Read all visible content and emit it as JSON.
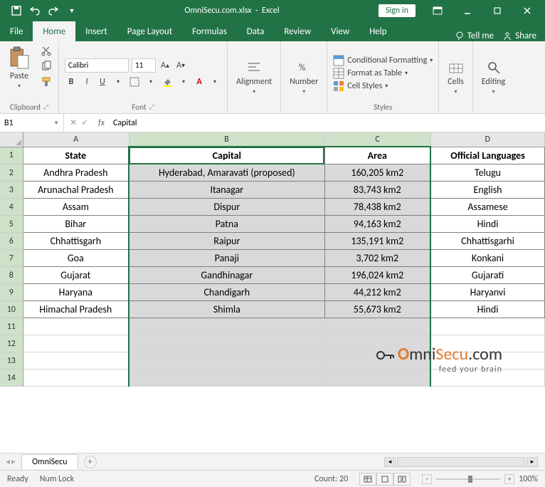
{
  "titlebar": {
    "filename": "OmniSecu.com.xlsx",
    "app": "Excel",
    "signin": "Sign in"
  },
  "tabs": {
    "file": "File",
    "home": "Home",
    "insert": "Insert",
    "pagelayout": "Page Layout",
    "formulas": "Formulas",
    "data": "Data",
    "review": "Review",
    "view": "View",
    "help": "Help",
    "tellme": "Tell me",
    "share": "Share"
  },
  "ribbon": {
    "paste": "Paste",
    "clipboard": "Clipboard",
    "font_name": "Calibri",
    "font_size": "11",
    "font": "Font",
    "alignment": "Alignment",
    "number": "Number",
    "cond_fmt": "Conditional Formatting",
    "fmt_table": "Format as Table",
    "cell_styles": "Cell Styles",
    "styles": "Styles",
    "cells": "Cells",
    "editing": "Editing"
  },
  "formula": {
    "cell_ref": "B1",
    "fx": "fx",
    "value": "Capital"
  },
  "columns": [
    "A",
    "B",
    "C",
    "D"
  ],
  "headers": [
    "State",
    "Capital",
    "Area",
    "Official Languages"
  ],
  "rows": [
    {
      "state": "Andhra Pradesh",
      "capital": "Hyderabad, Amaravati (proposed)",
      "area": "160,205 km2",
      "lang": "Telugu"
    },
    {
      "state": "Arunachal Pradesh",
      "capital": "Itanagar",
      "area": "83,743 km2",
      "lang": "English"
    },
    {
      "state": "Assam",
      "capital": "Dispur",
      "area": "78,438 km2",
      "lang": "Assamese"
    },
    {
      "state": "Bihar",
      "capital": "Patna",
      "area": "94,163 km2",
      "lang": "Hindi"
    },
    {
      "state": "Chhattisgarh",
      "capital": "Raipur",
      "area": "135,191 km2",
      "lang": "Chhattisgarhi"
    },
    {
      "state": "Goa",
      "capital": "Panaji",
      "area": "3,702 km2",
      "lang": "Konkani"
    },
    {
      "state": "Gujarat",
      "capital": "Gandhinagar",
      "area": "196,024 km2",
      "lang": "Gujarati"
    },
    {
      "state": "Haryana",
      "capital": "Chandigarh",
      "area": "44,212 km2",
      "lang": "Haryanvi"
    },
    {
      "state": "Himachal Pradesh",
      "capital": "Shimla",
      "area": "55,673 km2",
      "lang": "Hindi"
    }
  ],
  "sheet": {
    "name": "OmniSecu"
  },
  "status": {
    "ready": "Ready",
    "numlock": "Num Lock",
    "count": "Count: 20",
    "zoom": "100%"
  },
  "watermark": {
    "brand1": "mni",
    "brand2": "Secu",
    "brand3": ".com",
    "sub": "feed your brain"
  }
}
